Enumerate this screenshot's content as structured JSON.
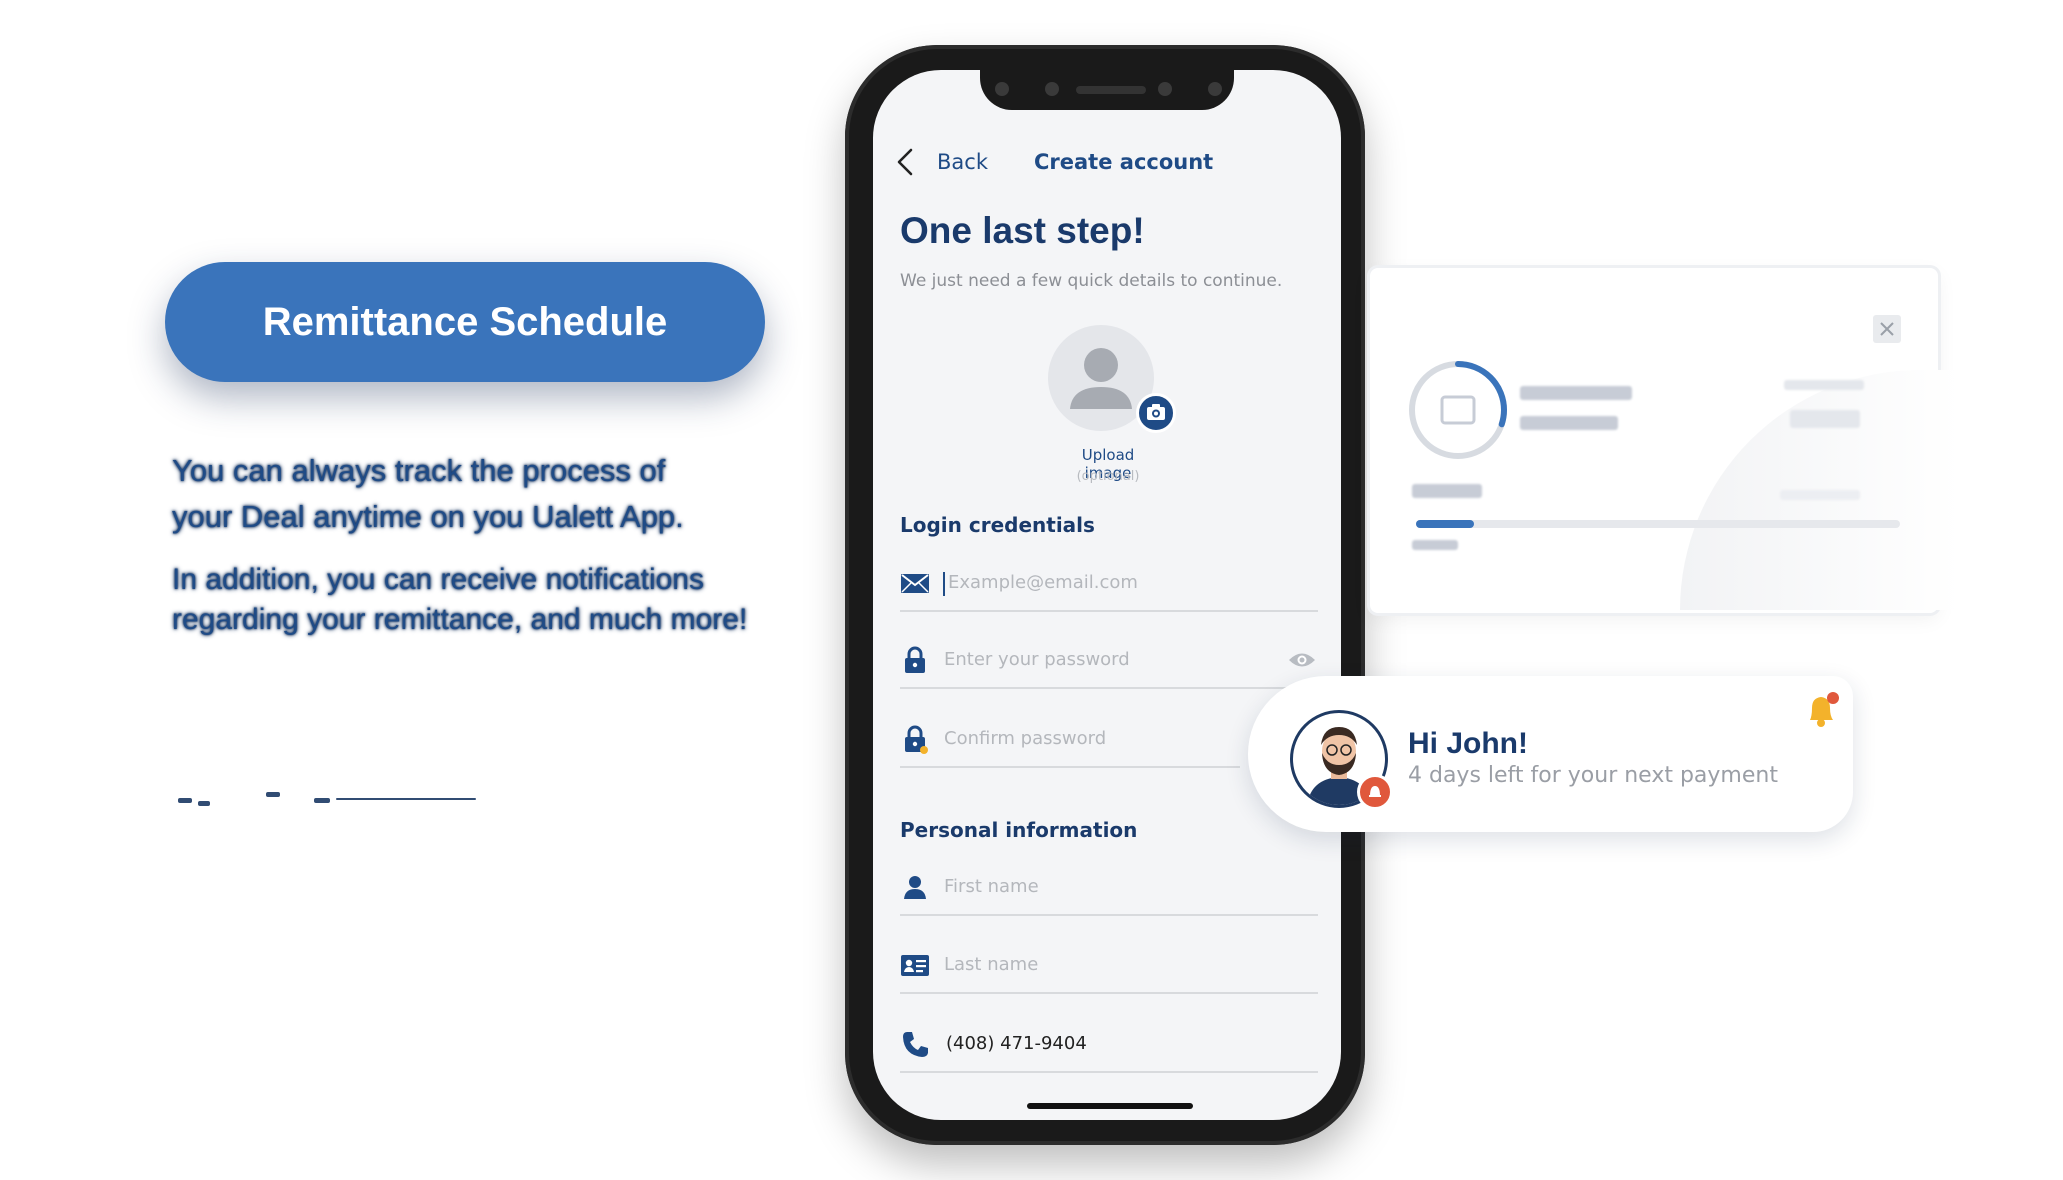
{
  "promo": {
    "heading": "Remittance Schedule",
    "line1": "You can always track the process of",
    "line2": "your Deal anytime on you Ualett App.",
    "paragraph2": "In addition, you can receive notifications regarding your remittance, and much more!"
  },
  "phone": {
    "nav": {
      "back_label": "Back",
      "title": "Create account"
    },
    "heading": "One last step!",
    "subheading": "We just need a few quick details to continue.",
    "upload": {
      "label": "Upload image",
      "optional": "(optional)"
    },
    "login_section": "Login credentials",
    "email_placeholder": "Example@email.com",
    "password_placeholder": "Enter your password",
    "confirm_placeholder": "Confirm password",
    "personal_section": "Personal information",
    "first_name_placeholder": "First name",
    "last_name_placeholder": "Last name",
    "phone_value": "(408) 471-9404"
  },
  "progress_card": {
    "progress_fraction": 0.12,
    "ring_fraction": 0.3
  },
  "notification": {
    "greeting": "Hi John!",
    "message": "4 days left for your next payment"
  },
  "colors": {
    "brand": "#3a74bb",
    "navy": "#1a3a6b",
    "alert": "#e0583c",
    "bell": "#f3b22b"
  }
}
